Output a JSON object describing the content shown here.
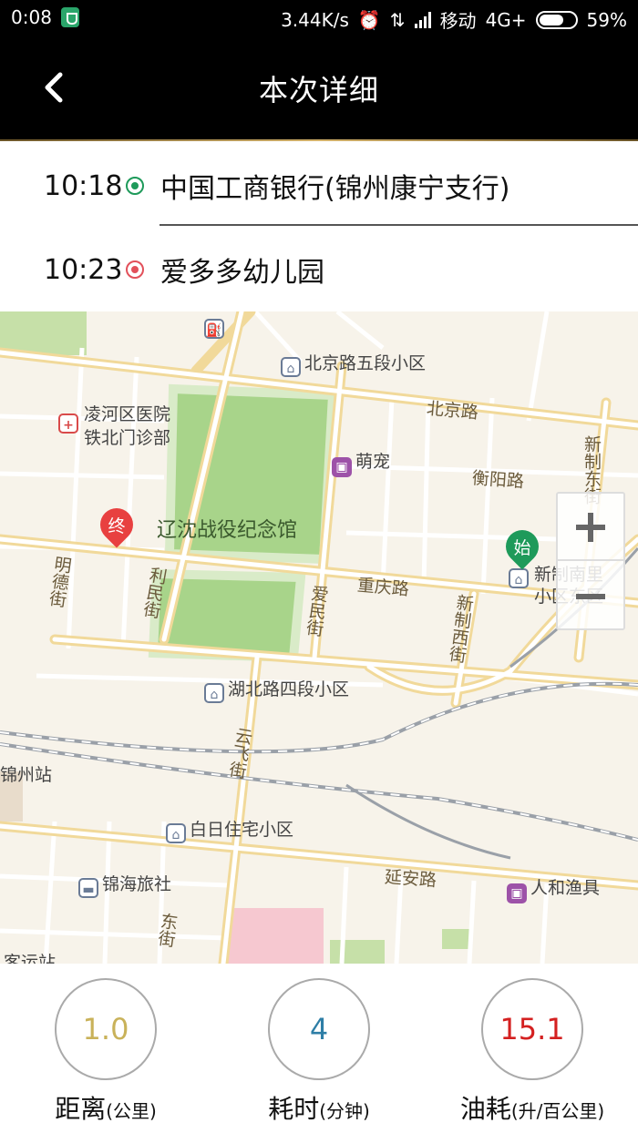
{
  "status_bar": {
    "time": "0:08",
    "net_speed": "3.44K/s",
    "carrier": "移动",
    "network": "4G+",
    "battery": "59%"
  },
  "header": {
    "title": "本次详细"
  },
  "route": {
    "start": {
      "time": "10:18",
      "place": "中国工商银行(锦州康宁支行)"
    },
    "end": {
      "time": "10:23",
      "place": "爱多多幼儿园"
    }
  },
  "map": {
    "labels": {
      "beijing_5": "北京路五段小区",
      "beijing_rd": "北京路",
      "hospital_1": "凌河区医院",
      "hospital_2": "铁北门诊部",
      "mengchong": "萌宠",
      "hengyang": "衡阳路",
      "xinzhi_east": "新制东街",
      "memorial": "辽沈战役纪念馆",
      "start_poi_1": "新制南里",
      "start_poi_2": "小区东区",
      "chongqing": "重庆路",
      "mingde": "明德街",
      "limin": "利民街",
      "aimin": "爱民街",
      "xinzhi_west": "新制西街",
      "hubei_4": "湖北路四段小区",
      "jinzhou_station": "锦州站",
      "yunfei": "云飞街",
      "bairi": "白日住宅小区",
      "yanan": "延安路",
      "jinhai": "锦海旅社",
      "renhe": "人和渔具",
      "keyun": "客运站",
      "dongjie": "东街"
    },
    "start_pin": "始",
    "end_pin": "终"
  },
  "stats": {
    "distance": {
      "value": "1.0",
      "label": "距离",
      "unit": "(公里)",
      "color": "#c9b25a"
    },
    "duration": {
      "value": "4",
      "label": "耗时",
      "unit": "(分钟)",
      "color": "#2e7ea6"
    },
    "fuel": {
      "value": "15.1",
      "label": "油耗",
      "unit": "(升/百公里)",
      "color": "#d42020"
    }
  }
}
